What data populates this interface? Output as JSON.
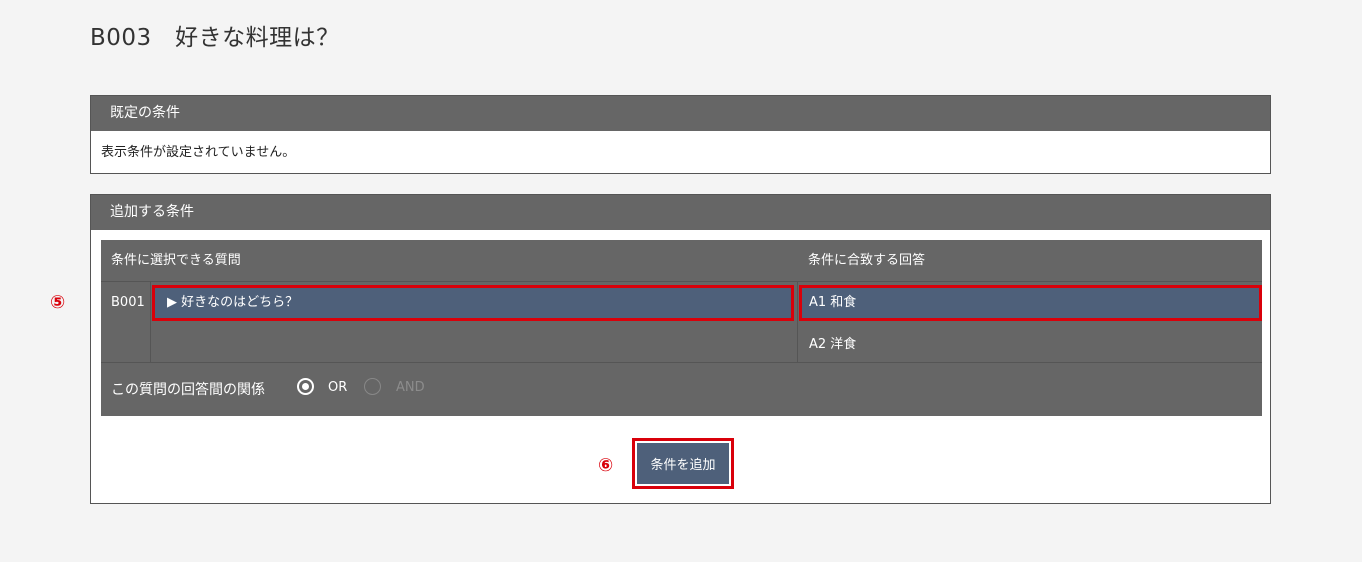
{
  "page": {
    "title": "B003　好きな料理は？"
  },
  "default_conditions": {
    "header": "既定の条件",
    "message": "表示条件が設定されていません。"
  },
  "add_conditions": {
    "header": "追加する条件",
    "table": {
      "col_question": "条件に選択できる質問",
      "col_answer": "条件に合致する回答",
      "question_id": "B001",
      "question_text": "▶ 好きなのはどちら？",
      "answers": [
        "A1 和食",
        "A2 洋食"
      ],
      "selected_answer_index": 0
    },
    "relation": {
      "label": "この質問の回答間の関係",
      "option_or": "OR",
      "option_and": "AND",
      "selected": "OR"
    },
    "add_button_label": "条件を追加"
  },
  "annotations": {
    "step5": "⑤",
    "step6": "⑥"
  },
  "colors": {
    "header_bg": "#666666",
    "selected_bg": "#4e607a",
    "annotation_red": "#d9000a"
  }
}
